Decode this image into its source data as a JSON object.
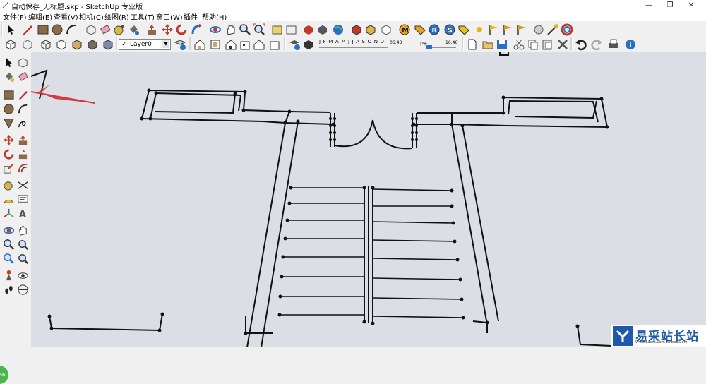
{
  "window": {
    "title": "自动保存_无标题.skp - SketchUp 专业版",
    "controls": {
      "minimize": "—",
      "maximize": "❐",
      "close": "✕"
    }
  },
  "menu": [
    "文件(F)",
    "编辑(E)",
    "查看(V)",
    "相机(C)",
    "绘图(R)",
    "工具(T)",
    "窗口(W)",
    "插件",
    "帮助(H)"
  ],
  "layer_selector": {
    "checked": "✓",
    "value": "Layer0"
  },
  "shadow_settings": {
    "months": "JFMAMJJASOND",
    "time_start": "06:43",
    "time_mid": "中午",
    "time_end": "16:46"
  },
  "badge": {
    "text": "66"
  },
  "watermark": {
    "text": "易采站长站",
    "subtext": "Www.Easck.Com  Wrweb.Com"
  },
  "colors": {
    "viewport_bg": "#dbdee4",
    "arrow": "#d43b3b",
    "accent": "#1d5aa8"
  }
}
